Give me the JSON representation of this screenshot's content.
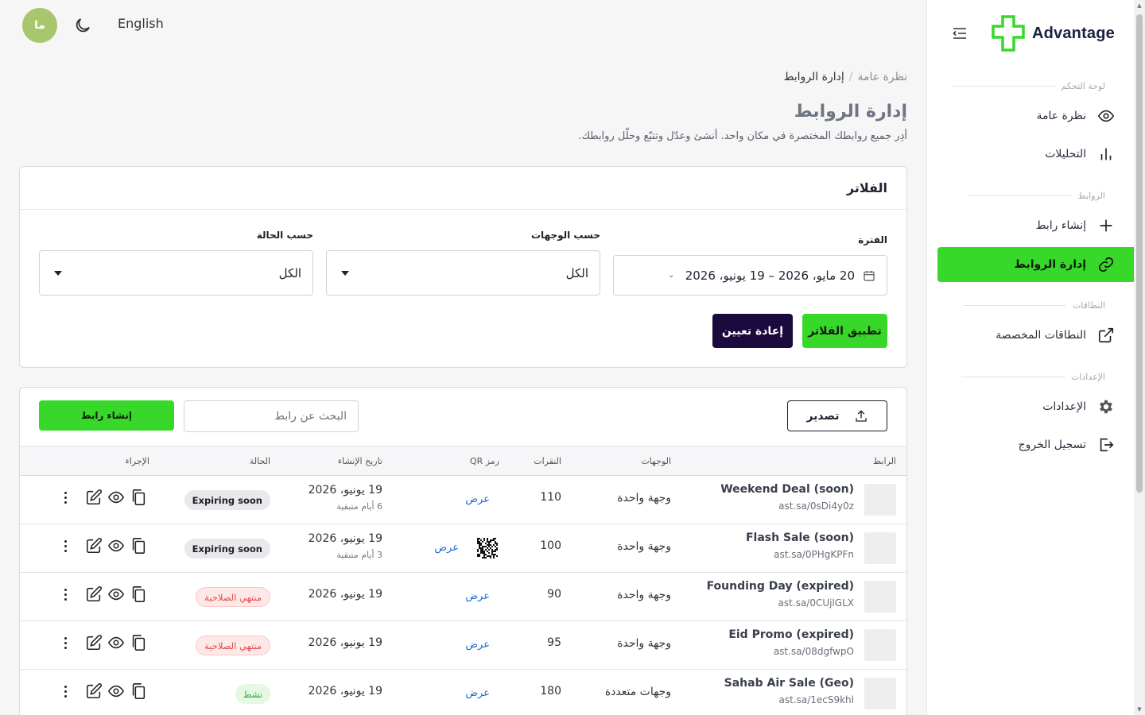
{
  "topbar": {
    "avatar_initials": "ما",
    "language": "English"
  },
  "sidebar": {
    "brand": "Advantage",
    "sections": {
      "dashboard": "لوحة التحكم",
      "links": "الروابط",
      "domains": "النطاقات",
      "settings": "الإعدادات"
    },
    "items": {
      "overview": "نظرة عامة",
      "analytics": "التحليلات",
      "create_link": "إنشاء رابط",
      "manage_links": "إدارة الروابط",
      "custom_domains": "النطاقات المخصصة",
      "settings": "الإعدادات",
      "logout": "تسجيل الخروج"
    },
    "active_color": "#37d82a"
  },
  "breadcrumb": {
    "root": "نظرة عامة",
    "separator": "/",
    "current": "إدارة الروابط"
  },
  "page": {
    "title": "إدارة الروابط",
    "subtitle": "أدِر جميع روابطك المختصرة في مكان واحد. أنشئ وعدّل وتتبّع وحلّل روابطك."
  },
  "filters": {
    "heading": "الفلاتر",
    "period_label": "الفترة",
    "period_value": "20 مايو، 2026 – 19 يونيو، 2026",
    "destinations_label": "حسب الوجهات",
    "destinations_value": "الكل",
    "status_label": "حسب الحالة",
    "status_value": "الكل",
    "apply_label": "تطبيق الفلاتر",
    "reset_label": "إعادة تعيين"
  },
  "table": {
    "export_label": "تصدير",
    "search_placeholder": "البحث عن رابط",
    "create_label": "إنشاء رابط",
    "columns": {
      "link": "الرابط",
      "destinations": "الوجهات",
      "clicks": "النقرات",
      "qr": "رمز QR",
      "created": "تاريخ الإنشاء",
      "status": "الحالة",
      "action": "الإجراء"
    },
    "rows": [
      {
        "name": "Weekend Deal (soon)",
        "url": "ast.sa/0sDi4y0z",
        "destinations": "وجهة واحدة",
        "clicks": "110",
        "qr": "عرض",
        "date": "19 يونيو، 2026",
        "remaining": "6 أيام متبقية",
        "status": "Expiring soon"
      },
      {
        "name": "Flash Sale (soon)",
        "url": "ast.sa/0PHgKPFn",
        "destinations": "وجهة واحدة",
        "clicks": "100",
        "qr": "عرض",
        "date": "19 يونيو، 2026",
        "remaining": "3 أيام متبقية",
        "status": "Expiring soon"
      },
      {
        "name": "Founding Day (expired)",
        "url": "ast.sa/0CUjlGLX",
        "destinations": "وجهة واحدة",
        "clicks": "90",
        "qr": "عرض",
        "date": "19 يونيو، 2026",
        "remaining": "",
        "status": "منتهي الصلاحية"
      },
      {
        "name": "Eid Promo (expired)",
        "url": "ast.sa/08dgfwpO",
        "destinations": "وجهة واحدة",
        "clicks": "95",
        "qr": "عرض",
        "date": "19 يونيو، 2026",
        "remaining": "",
        "status": "منتهي الصلاحية"
      },
      {
        "name": "Sahab Air Sale (Geo)",
        "url": "ast.sa/1ecS9khl",
        "destinations": "وجهات متعددة",
        "clicks": "180",
        "qr": "عرض",
        "date": "19 يونيو، 2026",
        "remaining": "",
        "status": "نشط"
      }
    ]
  }
}
